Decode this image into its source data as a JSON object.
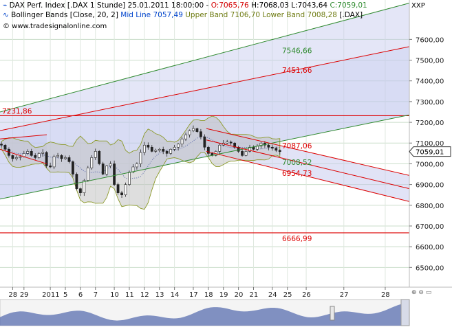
{
  "header": {
    "instrument": "DAX Perf. Index [.DAX  1 Stunde] 25.01.2011 18:00:00",
    "open": "O:7065,76",
    "high": "H:7068,03",
    "low": "L:7043,64",
    "close": "C:7059,01",
    "indicator_name": "Bollinger Bands [Close, 20, 2]",
    "mid_line": "Mid Line 7057,49",
    "upper_band": "Upper Band 7106,70",
    "lower_band": "Lower Band 7008,28",
    "indicator_source": "[.DAX]",
    "copyright": "© www.tradesignalonline.com",
    "symbol_label": "XXP"
  },
  "chart_data": {
    "type": "candlestick",
    "title": "DAX Perf. Index [.DAX  1 Stunde]",
    "ylim": [
      6405,
      7790
    ],
    "y_ticks": [
      6500,
      6600,
      6700,
      6800,
      6900,
      7000,
      7100,
      7200,
      7300,
      7400,
      7500,
      7600
    ],
    "y_tick_labels": [
      "6500,00",
      "6600,00",
      "6700,00",
      "6800,00",
      "6900,00",
      "7000,00",
      "7100,00",
      "7200,00",
      "7300,00",
      "7400,00",
      "7500,00",
      "7600,00"
    ],
    "x_labels": [
      "28",
      "29",
      "2011",
      "5",
      "6",
      "7",
      "10",
      "11",
      "12",
      "13",
      "14",
      "17",
      "18",
      "19",
      "20",
      "21",
      "24",
      "25",
      "26",
      "27",
      "28"
    ],
    "x_label_bars": [
      3,
      6,
      13,
      17,
      21,
      25,
      30,
      34,
      38,
      42,
      46,
      51,
      55,
      59,
      63,
      67,
      72,
      76,
      81,
      91,
      102
    ],
    "current_price_label": "7059,01",
    "current_price": 7059.01,
    "horizontal_levels": [
      {
        "value": 7231.86,
        "label": "7231,86",
        "color": "#dd0000"
      },
      {
        "value": 6666.99,
        "label": "6666,99",
        "color": "#dd0000"
      }
    ],
    "channel_labels": [
      {
        "text": "7546,66",
        "color": "#2f8a2f"
      },
      {
        "text": "7451,66",
        "color": "#dd0000"
      },
      {
        "text": "7087,06",
        "color": "#dd0000"
      },
      {
        "text": "7008,52",
        "color": "#2f8a2f"
      },
      {
        "text": "6954,73",
        "color": "#dd0000"
      }
    ],
    "bollinger": {
      "period": 20,
      "deviation": 2,
      "mid_line": 7057.49,
      "upper_band": 7106.7,
      "lower_band": 7008.28
    },
    "closes": [
      7090,
      7070,
      7040,
      7025,
      7030,
      7035,
      7050,
      7060,
      7040,
      7030,
      7050,
      7055,
      6990,
      6985,
      7035,
      7040,
      7025,
      7030,
      7010,
      6950,
      6880,
      6860,
      6920,
      6980,
      7030,
      7060,
      7000,
      6950,
      6990,
      7000,
      6900,
      6860,
      6850,
      6900,
      6960,
      6985,
      7000,
      7055,
      7090,
      7080,
      7060,
      7065,
      7070,
      7060,
      7050,
      7070,
      7080,
      7095,
      7120,
      7140,
      7160,
      7170,
      7155,
      7130,
      7080,
      7050,
      7040,
      7060,
      7090,
      7100,
      7105,
      7100,
      7080,
      7060,
      7040,
      7060,
      7080,
      7070,
      7085,
      7100,
      7090,
      7080,
      7075,
      7065,
      7059
    ],
    "colors": {
      "band_fill": "#c4c8ee",
      "bollinger_fill": "#c3c3c3",
      "bollinger_outline": "#8c9a2a",
      "channel_green": "#2f8a2f",
      "channel_red": "#dd0000",
      "candle": "#222222"
    }
  },
  "scrollbar": {
    "label": "navigator"
  }
}
